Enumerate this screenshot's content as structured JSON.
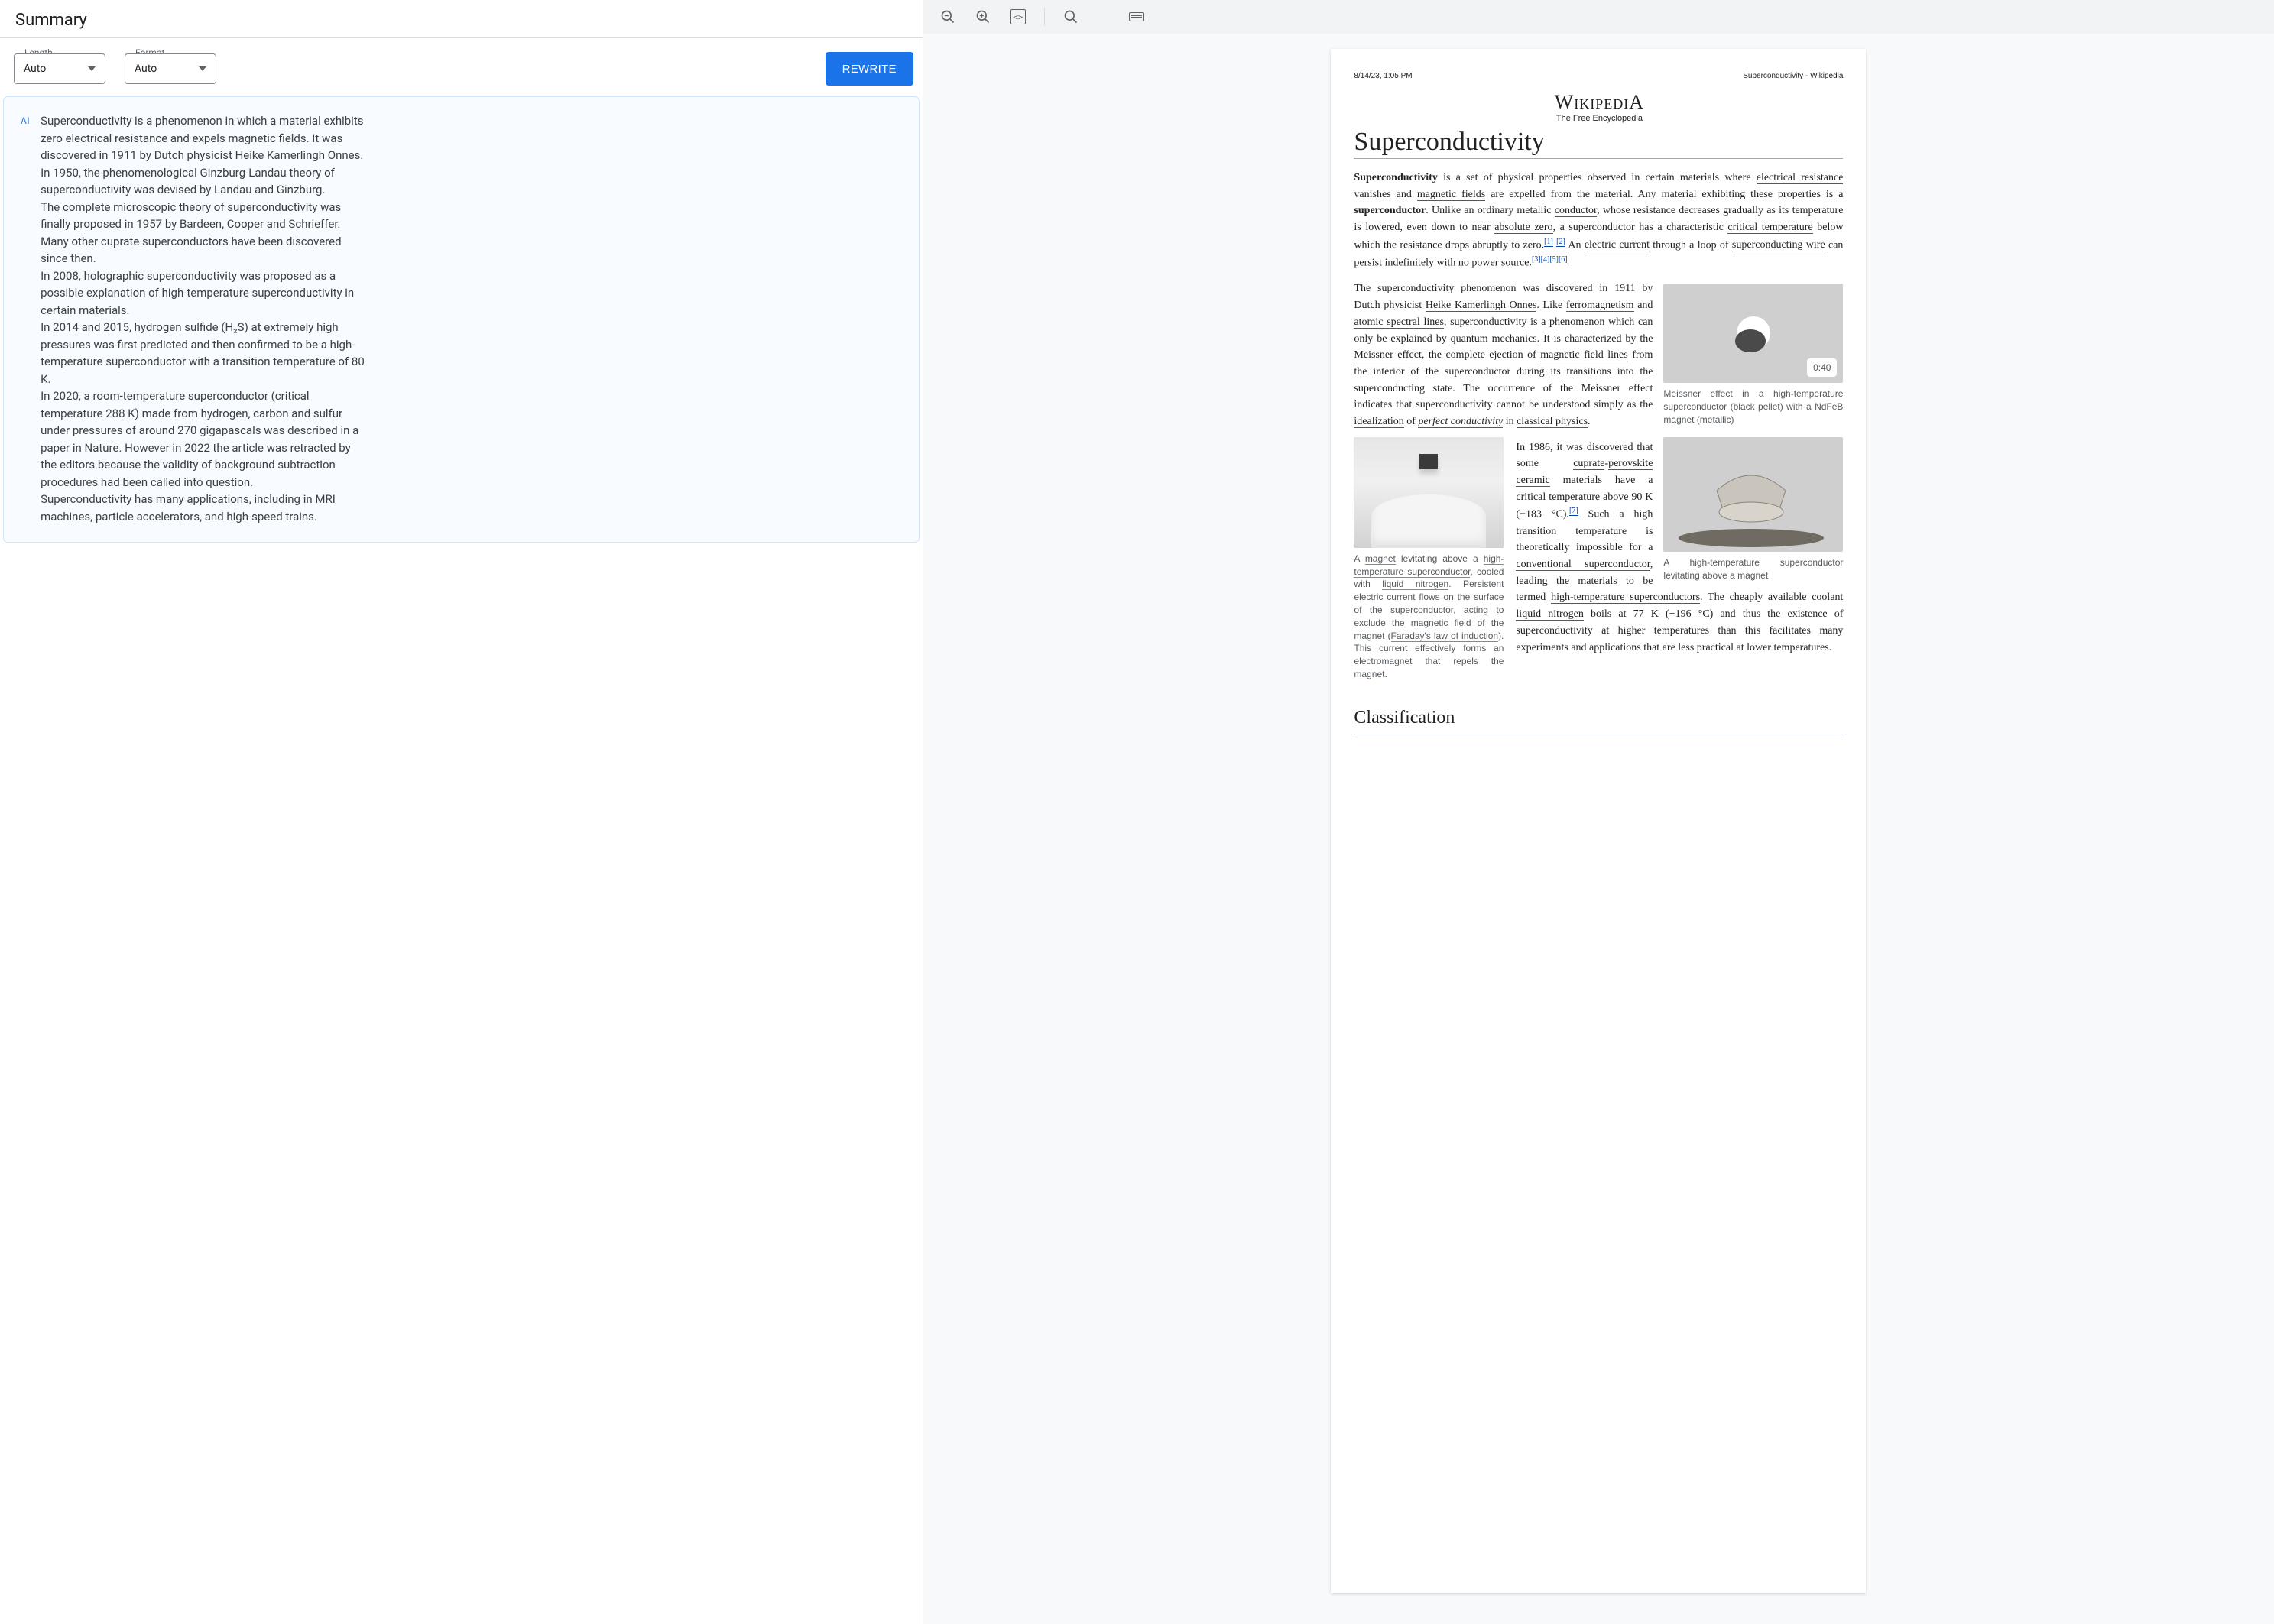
{
  "left": {
    "title": "Summary",
    "length_label": "Length",
    "length_value": "Auto",
    "format_label": "Format",
    "format_value": "Auto",
    "rewrite": "REWRITE",
    "ai_chip": "AI",
    "summary_text": "Superconductivity is a phenomenon in which a material exhibits zero electrical resistance and expels magnetic fields. It was discovered in 1911 by Dutch physicist Heike Kamerlingh Onnes.\nIn 1950, the phenomenological Ginzburg-Landau theory of superconductivity was devised by Landau and Ginzburg.\nThe complete microscopic theory of superconductivity was finally proposed in 1957 by Bardeen, Cooper and Schrieffer.\nMany other cuprate superconductors have been discovered since then.\nIn 2008, holographic superconductivity was proposed as a possible explanation of high-temperature superconductivity in certain materials.\nIn 2014 and 2015, hydrogen sulfide (H₂S) at extremely high pressures was first predicted and then confirmed to be a high-temperature superconductor with a transition temperature of 80 K.\nIn 2020, a room-temperature superconductor (critical temperature 288 K) made from hydrogen, carbon and sulfur under pressures of around 270 gigapascals was described in a paper in Nature. However in 2022 the article was retracted by the editors because the validity of background subtraction procedures had been called into question.\nSuperconductivity has many applications, including in MRI machines, particle accelerators, and high-speed trains."
  },
  "toolbar": {
    "zoom_out": "zoom-out-icon",
    "zoom_in": "zoom-in-icon",
    "code": "code-icon",
    "search": "search-icon",
    "keyboard": "keyboard-icon"
  },
  "doc": {
    "timestamp": "8/14/23, 1:05 PM",
    "header_right": "Superconductivity - Wikipedia",
    "logo_main": "WikipediA",
    "logo_tag": "The Free Encyclopedia",
    "title": "Superconductivity",
    "p1_a": "Superconductivity",
    "p1_b": " is a set of physical properties observed in certain materials where ",
    "p1_c": "electrical resistance",
    "p1_d": " vanishes and ",
    "p1_e": "magnetic fields",
    "p1_f": " are expelled from the material. Any material exhibiting these properties is a ",
    "p1_g": "superconductor",
    "p1_h": ". Unlike an ordinary metallic ",
    "p1_i": "conductor",
    "p1_j": ", whose resistance decreases gradually as its temperature is lowered, even down to near ",
    "p1_k": "absolute zero",
    "p1_l": ", a superconductor has a characteristic ",
    "p1_m": "critical temperature",
    "p1_n": " below which the resistance drops abruptly to zero.",
    "p1_ref1": "[1]",
    "p1_ref2": "[2]",
    "p1_o": " An ",
    "p1_p": "electric current",
    "p1_q": " through a loop of ",
    "p1_r": "superconducting wire",
    "p1_s": " can persist indefinitely with no power source.",
    "p1_ref3": "[3]",
    "p1_ref4": "[4]",
    "p1_ref5": "[5]",
    "p1_ref6": "[6]",
    "fig_left_cap_a": "A ",
    "fig_left_cap_b": "magnet",
    "fig_left_cap_c": " levitating above a ",
    "fig_left_cap_d": "high-temperature superconductor",
    "fig_left_cap_e": ", cooled with ",
    "fig_left_cap_f": "liquid nitrogen",
    "fig_left_cap_g": ". Persistent electric current flows on the surface of the superconductor, acting to exclude the magnetic field of the magnet (",
    "fig_left_cap_h": "Faraday's law of induction",
    "fig_left_cap_i": "). This current effectively forms an electromagnet that repels the magnet.",
    "fig_r1_dur": "0:40",
    "fig_r1_cap": "Meissner effect in a high-temperature superconductor (black pellet) with a NdFeB magnet (metallic)",
    "fig_r2_cap": "A high-temperature superconductor levitating above a magnet",
    "p2_a": "The superconductivity phenomenon was discovered in 1911 by Dutch physicist ",
    "p2_b": "Heike Kamerlingh Onnes",
    "p2_c": ". Like ",
    "p2_d": "ferromagnetism",
    "p2_e": " and ",
    "p2_f": "atomic spectral lines",
    "p2_g": ", superconductivity is a phenomenon which can only be explained by ",
    "p2_h": "quantum mechanics",
    "p2_i": ". It is characterized by the ",
    "p2_j": "Meissner effect",
    "p2_k": ", the complete ejection of ",
    "p2_l": "magnetic field lines",
    "p2_m": " from the interior of the superconductor during its transitions into the superconducting state. The occurrence of the Meissner effect indicates that superconductivity cannot be understood simply as the ",
    "p2_n": "idealization",
    "p2_o": " of ",
    "p2_p": "perfect conductivity",
    "p2_q": " in ",
    "p2_r": "classical physics",
    "p2_s": ".",
    "p3_a": "In 1986, it was discovered that some ",
    "p3_b": "cuprate",
    "p3_c": "-",
    "p3_d": "perovskite",
    "p3_e": " ",
    "p3_f": "ceramic",
    "p3_g": " materials have a critical temperature above 90 K (−183 °C).",
    "p3_ref7": "[7]",
    "p3_h": " Such a high transition temperature is theoretically impossible for a ",
    "p3_i": "conventional superconductor",
    "p3_j": ", leading the materials to be termed ",
    "p3_k": "high-temperature superconductors",
    "p3_l": ". The cheaply available coolant ",
    "p3_m": "liquid nitrogen",
    "p3_n": " boils at 77 K (−196 °C) and thus the existence of superconductivity at higher temperatures than this facilitates many experiments and applications that are less practical at lower temperatures.",
    "h2": "Classification"
  }
}
